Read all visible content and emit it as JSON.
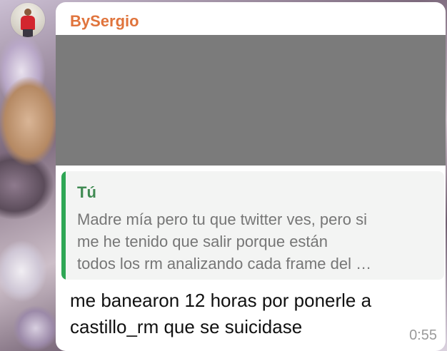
{
  "chat": {
    "sender_name": "BySergio",
    "reply": {
      "author": "Tú",
      "lines": [
        "Madre mía pero tu que twitter ves, pero si",
        "me he tenido que salir porque están",
        "todos los rm analizando cada frame del …"
      ]
    },
    "message": {
      "lines": [
        "me banearon 12 horas por ponerle a",
        "castillo_rm que se suicidase"
      ],
      "time": "0:55"
    }
  },
  "colors": {
    "sender_name": "#e0743c",
    "reply_bar": "#2ea654",
    "reply_author": "#3f8a52",
    "media_placeholder": "#7b7b7b",
    "bubble": "#ffffff"
  }
}
